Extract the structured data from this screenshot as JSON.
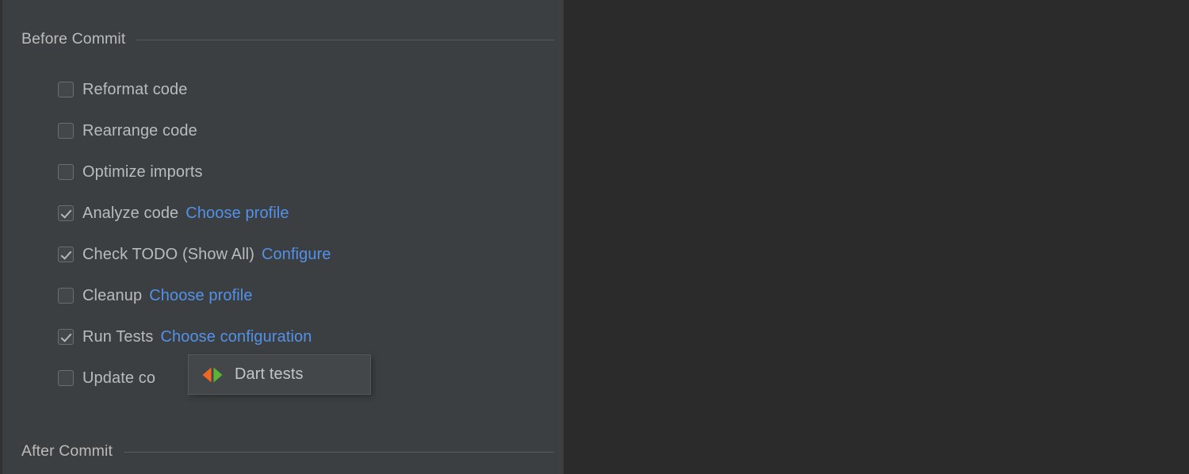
{
  "panel": {
    "sections": [
      {
        "id": "before-commit",
        "title": "Before Commit"
      },
      {
        "id": "after-commit",
        "title": "After Commit"
      }
    ]
  },
  "before_commit": {
    "options": [
      {
        "label": "Reformat code",
        "checked": false,
        "link": ""
      },
      {
        "label": "Rearrange code",
        "checked": false,
        "link": ""
      },
      {
        "label": "Optimize imports",
        "checked": false,
        "link": ""
      },
      {
        "label": "Analyze code",
        "checked": true,
        "link": "Choose profile"
      },
      {
        "label": "Check TODO (Show All)",
        "checked": true,
        "link": "Configure"
      },
      {
        "label": "Cleanup",
        "checked": false,
        "link": "Choose profile"
      },
      {
        "label": "Run Tests",
        "checked": true,
        "link": "Choose configuration"
      },
      {
        "label": "Update co",
        "checked": false,
        "link": ""
      }
    ]
  },
  "popup": {
    "items": [
      {
        "label": "Dart tests",
        "icon": "dart-run-icon"
      }
    ]
  },
  "colors": {
    "panel_background": "#3c3f41",
    "editor_background": "#2b2b2b",
    "text": "#b9bbbd",
    "link": "#5391e8",
    "popup_background": "#43474a",
    "popup_border": "#55595b",
    "checkbox_border": "#6b6e70",
    "checkmark": "#b6b9ba",
    "separator": "#5c5a56",
    "dart_icon_left": "#f26522",
    "dart_icon_right": "#5cb336"
  }
}
